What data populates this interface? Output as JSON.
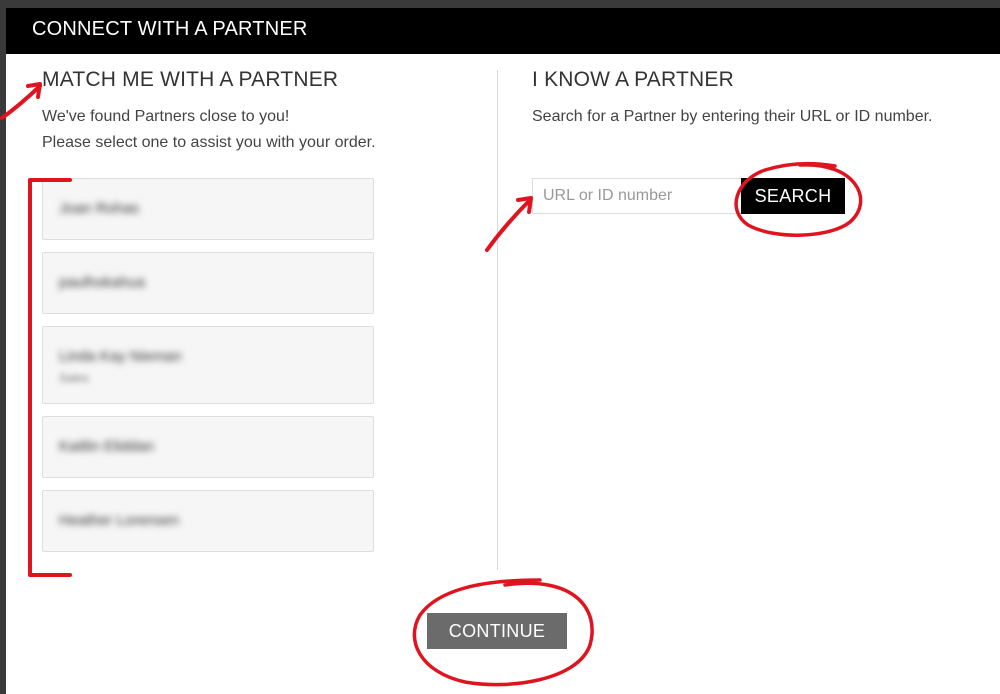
{
  "modal": {
    "title": "CONNECT WITH A PARTNER"
  },
  "match": {
    "heading": "MATCH ME WITH A PARTNER",
    "line1": "We've found Partners close to you!",
    "line2": "Please select one to assist you with your order.",
    "partners": [
      {
        "name": "Joan Rohas",
        "sub": ""
      },
      {
        "name": "paulhokahua",
        "sub": ""
      },
      {
        "name": "Linda Kay Nieman",
        "sub": "Sales"
      },
      {
        "name": "Kaitlin Eliddan",
        "sub": ""
      },
      {
        "name": "Heather Lorensen",
        "sub": ""
      }
    ]
  },
  "know": {
    "heading": "I KNOW A PARTNER",
    "description": "Search for a Partner by entering their URL or ID number.",
    "search_placeholder": "URL or ID number",
    "search_label": "SEARCH"
  },
  "footer": {
    "continue_label": "CONTINUE"
  },
  "colors": {
    "header_bg": "#000000",
    "annotation_red": "#e0141f",
    "continue_bg": "#6b6b6b"
  }
}
